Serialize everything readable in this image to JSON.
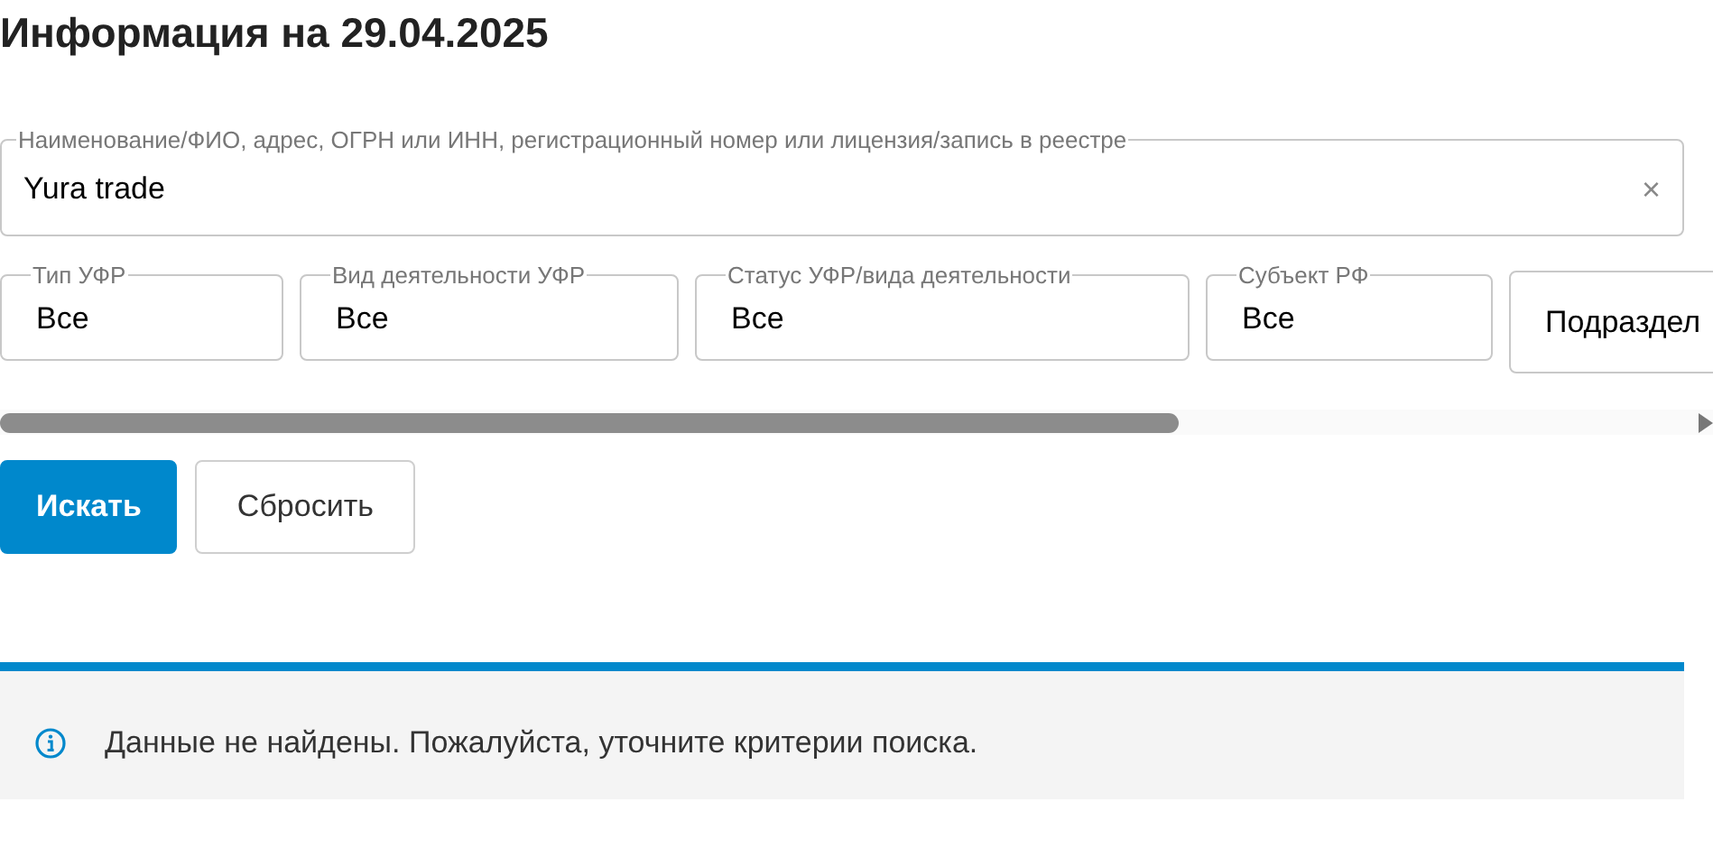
{
  "title": "Информация на 29.04.2025",
  "search": {
    "label": "Наименование/ФИО, адрес, ОГРН или ИНН, регистрационный номер или лицензия/запись в реестре",
    "value": "Yura trade",
    "clear": "×"
  },
  "filters": [
    {
      "label": "Тип УФР",
      "value": "Все"
    },
    {
      "label": "Вид деятельности УФР",
      "value": "Все"
    },
    {
      "label": "Статус УФР/вида деятельности",
      "value": "Все"
    },
    {
      "label": "Субъект РФ",
      "value": "Все"
    },
    {
      "value": "Подраздел"
    }
  ],
  "buttons": [
    {
      "label": "Искать",
      "kind": "primary"
    },
    {
      "label": "Сбросить",
      "kind": "secondary"
    }
  ],
  "alert": {
    "message": "Данные не найдены. Пожалуйста, уточните критерии поиска."
  }
}
